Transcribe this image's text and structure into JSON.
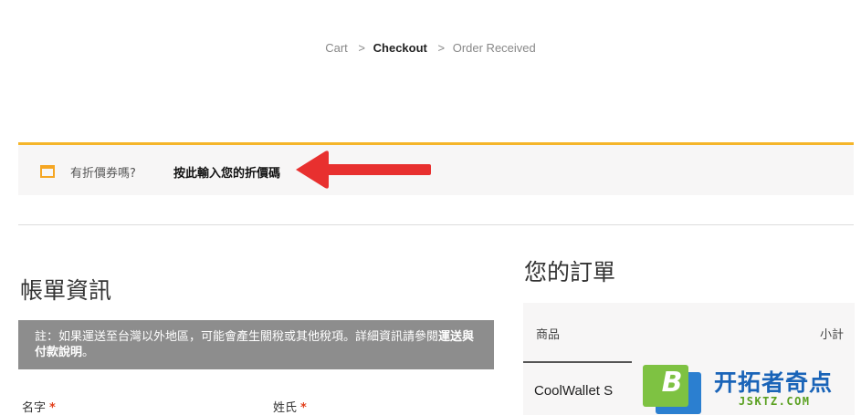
{
  "breadcrumb": {
    "items": [
      "Cart",
      "Checkout",
      "Order Received"
    ],
    "separator": ">"
  },
  "coupon": {
    "prompt": "有折價券嗎?",
    "link_label": "按此輸入您的折價碼",
    "accent_color": "#f5b52a"
  },
  "annotation": {
    "icon": "red-arrow-left-icon",
    "color": "#e8302f"
  },
  "billing": {
    "title": "帳單資訊",
    "notice_text": "註：如果運送至台灣以外地區，可能會產生關稅或其他稅項。詳細資訊請參閱",
    "notice_link": "運送與付款說明",
    "notice_end": "。",
    "first_name_label": "名字",
    "last_name_label": "姓氏",
    "required_mark": "*"
  },
  "order": {
    "title": "您的訂單",
    "col_product": "商品",
    "col_subtotal": "小計",
    "first_item": "CoolWallet S"
  },
  "watermark": {
    "badge_letter": "B",
    "title": "开拓者奇点",
    "url": "JSKTZ.COM"
  }
}
